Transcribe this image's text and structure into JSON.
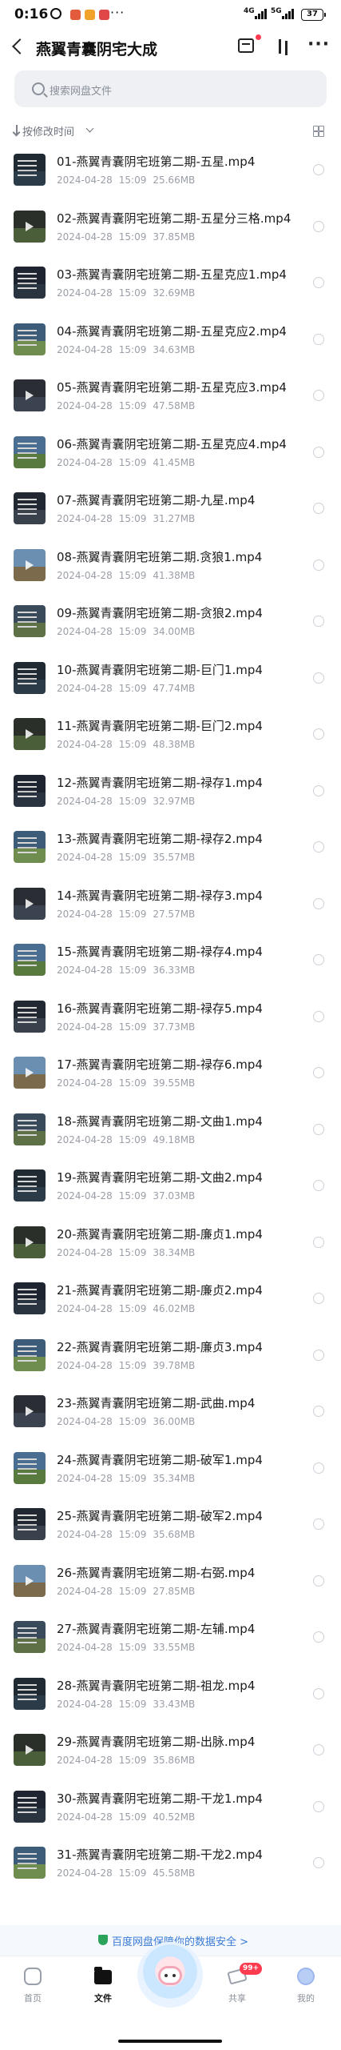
{
  "status_bar": {
    "time": "0:16",
    "net1": "4G",
    "net2": "5G",
    "battery": "37",
    "colors": {
      "app1": "#e25b3a",
      "app2": "#f0a22b",
      "app3": "#e04848"
    }
  },
  "header": {
    "title": "燕翼青囊阴宅大成",
    "icons": [
      "back-icon",
      "transfer-icon",
      "sort-arrows-icon",
      "more-icon"
    ]
  },
  "search": {
    "placeholder": "搜索网盘文件"
  },
  "sort": {
    "label": "按修改时间"
  },
  "files": [
    {
      "name": "01-燕翼青囊阴宅班第二期-五星.mp4",
      "date": "2024-04-28",
      "time": "15:09",
      "size": "25.66MB"
    },
    {
      "name": "02-燕翼青囊阴宅班第二期-五星分三格.mp4",
      "date": "2024-04-28",
      "time": "15:09",
      "size": "37.85MB"
    },
    {
      "name": "03-燕翼青囊阴宅班第二期-五星克应1.mp4",
      "date": "2024-04-28",
      "time": "15:09",
      "size": "32.69MB"
    },
    {
      "name": "04-燕翼青囊阴宅班第二期-五星克应2.mp4",
      "date": "2024-04-28",
      "time": "15:09",
      "size": "34.63MB"
    },
    {
      "name": "05-燕翼青囊阴宅班第二期-五星克应3.mp4",
      "date": "2024-04-28",
      "time": "15:09",
      "size": "47.58MB"
    },
    {
      "name": "06-燕翼青囊阴宅班第二期-五星克应4.mp4",
      "date": "2024-04-28",
      "time": "15:09",
      "size": "41.45MB"
    },
    {
      "name": "07-燕翼青囊阴宅班第二期-九星.mp4",
      "date": "2024-04-28",
      "time": "15:09",
      "size": "31.27MB"
    },
    {
      "name": "08-燕翼青囊阴宅班第二期.贪狼1.mp4",
      "date": "2024-04-28",
      "time": "15:09",
      "size": "41.38MB"
    },
    {
      "name": "09-燕翼青囊阴宅班第二期-贪狼2.mp4",
      "date": "2024-04-28",
      "time": "15:09",
      "size": "34.00MB"
    },
    {
      "name": "10-燕翼青囊阴宅班第二期-巨门1.mp4",
      "date": "2024-04-28",
      "time": "15:09",
      "size": "47.74MB"
    },
    {
      "name": "11-燕翼青囊阴宅班第二期-巨门2.mp4",
      "date": "2024-04-28",
      "time": "15:09",
      "size": "48.38MB"
    },
    {
      "name": "12-燕翼青囊阴宅班第二期-禄存1.mp4",
      "date": "2024-04-28",
      "time": "15:09",
      "size": "32.97MB"
    },
    {
      "name": "13-燕翼青囊阴宅班第二期-禄存2.mp4",
      "date": "2024-04-28",
      "time": "15:09",
      "size": "35.57MB"
    },
    {
      "name": "14-燕翼青囊阴宅班第二期-禄存3.mp4",
      "date": "2024-04-28",
      "time": "15:09",
      "size": "27.57MB"
    },
    {
      "name": "15-燕翼青囊阴宅班第二期-禄存4.mp4",
      "date": "2024-04-28",
      "time": "15:09",
      "size": "36.33MB"
    },
    {
      "name": "16-燕翼青囊阴宅班第二期-禄存5.mp4",
      "date": "2024-04-28",
      "time": "15:09",
      "size": "37.73MB"
    },
    {
      "name": "17-燕翼青囊阴宅班第二期-禄存6.mp4",
      "date": "2024-04-28",
      "time": "15:09",
      "size": "39.55MB"
    },
    {
      "name": "18-燕翼青囊阴宅班第二期-文曲1.mp4",
      "date": "2024-04-28",
      "time": "15:09",
      "size": "49.18MB"
    },
    {
      "name": "19-燕翼青囊阴宅班第二期-文曲2.mp4",
      "date": "2024-04-28",
      "time": "15:09",
      "size": "37.03MB"
    },
    {
      "name": "20-燕翼青囊阴宅班第二期-廉贞1.mp4",
      "date": "2024-04-28",
      "time": "15:09",
      "size": "38.34MB"
    },
    {
      "name": "21-燕翼青囊阴宅班第二期-廉贞2.mp4",
      "date": "2024-04-28",
      "time": "15:09",
      "size": "46.02MB"
    },
    {
      "name": "22-燕翼青囊阴宅班第二期-廉贞3.mp4",
      "date": "2024-04-28",
      "time": "15:09",
      "size": "39.78MB"
    },
    {
      "name": "23-燕翼青囊阴宅班第二期-武曲.mp4",
      "date": "2024-04-28",
      "time": "15:09",
      "size": "36.00MB"
    },
    {
      "name": "24-燕翼青囊阴宅班第二期-破军1.mp4",
      "date": "2024-04-28",
      "time": "15:09",
      "size": "35.34MB"
    },
    {
      "name": "25-燕翼青囊阴宅班第二期-破军2.mp4",
      "date": "2024-04-28",
      "time": "15:09",
      "size": "35.68MB"
    },
    {
      "name": "26-燕翼青囊阴宅班第二期-右弼.mp4",
      "date": "2024-04-28",
      "time": "15:09",
      "size": "27.85MB"
    },
    {
      "name": "27-燕翼青囊阴宅班第二期-左辅.mp4",
      "date": "2024-04-28",
      "time": "15:09",
      "size": "33.55MB"
    },
    {
      "name": "28-燕翼青囊阴宅班第二期-祖龙.mp4",
      "date": "2024-04-28",
      "time": "15:09",
      "size": "33.43MB"
    },
    {
      "name": "29-燕翼青囊阴宅班第二期-出脉.mp4",
      "date": "2024-04-28",
      "time": "15:09",
      "size": "35.86MB"
    },
    {
      "name": "30-燕翼青囊阴宅班第二期-干龙1.mp4",
      "date": "2024-04-28",
      "time": "15:09",
      "size": "40.52MB"
    },
    {
      "name": "31-燕翼青囊阴宅班第二期-干龙2.mp4",
      "date": "2024-04-28",
      "time": "15:09",
      "size": "45.58MB"
    }
  ],
  "security_banner": {
    "text": "百度网盘保障你的数据安全 >",
    "icon": "shield-icon"
  },
  "bottom_nav": {
    "items": [
      {
        "label": "首页",
        "icon": "home-icon"
      },
      {
        "label": "文件",
        "icon": "folder-icon",
        "active": true
      },
      {
        "label": "共享",
        "icon": "share-icon",
        "badge": "99+"
      },
      {
        "label": "我的",
        "icon": "avatar-icon"
      }
    ]
  }
}
